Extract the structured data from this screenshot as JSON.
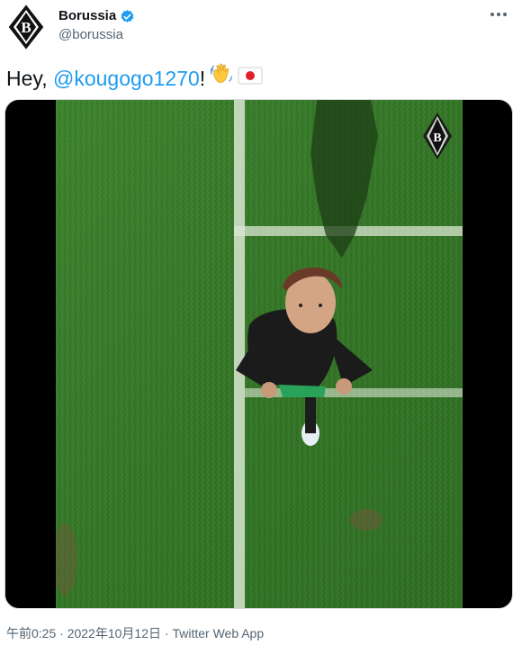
{
  "tweet": {
    "author": {
      "display_name": "Borussia",
      "handle": "@borussia",
      "avatar_icon": "borussia-crest-icon",
      "verified": true
    },
    "more_icon": "more-dots-icon",
    "text_prefix": "Hey, ",
    "mention": "@kougogo1270",
    "text_suffix": "!",
    "emojis": [
      "waving-hand-icon",
      "japan-flag-icon"
    ],
    "media": {
      "type": "video",
      "watermark_icon": "borussia-crest-icon"
    },
    "footer": {
      "time": "午前0:25",
      "separator": " · ",
      "date": "2022年10月12日",
      "separator2": " · ",
      "source": "Twitter Web App"
    }
  },
  "colors": {
    "link": "#1d9bf0",
    "secondary_text": "#536471",
    "primary_text": "#0f1419",
    "grass": "#3a7a2e"
  }
}
